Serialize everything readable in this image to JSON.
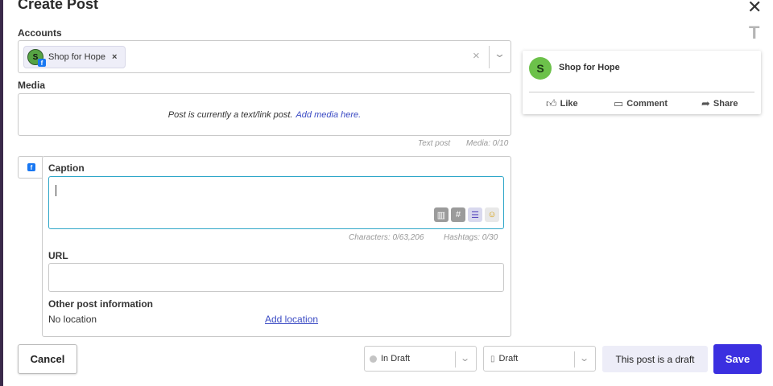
{
  "modal": {
    "title": "Create Post"
  },
  "accounts": {
    "label": "Accounts",
    "selected": [
      {
        "avatar_letter": "S",
        "name": "Shop for Hope",
        "network": "facebook"
      }
    ],
    "remove_glyph": "×",
    "clear_glyph": "×"
  },
  "media": {
    "label": "Media",
    "message": "Post is currently a text/link post.",
    "link": "Add media here.",
    "post_type": "Text post",
    "count": "Media: 0/10"
  },
  "caption": {
    "label": "Caption",
    "network_badge": "f",
    "characters": "Characters: 0/63,206",
    "hashtags": "Hashtags: 0/30",
    "tools": [
      "library-icon",
      "hashtag-icon",
      "comment-icon",
      "emoji-icon"
    ]
  },
  "url": {
    "label": "URL",
    "value": ""
  },
  "other_info": {
    "label": "Other post information",
    "location": "No location",
    "add_location": "Add location"
  },
  "preview": {
    "avatar_letter": "S",
    "name": "Shop for Hope",
    "actions": {
      "like": "Like",
      "comment": "Comment",
      "share": "Share"
    }
  },
  "footer": {
    "cancel": "Cancel",
    "status": "In Draft",
    "draft_select": "Draft",
    "draft_note": "This post is a draft",
    "save": "Save"
  },
  "colors": {
    "accent": "#3b2fe0",
    "link": "#3b4bc4",
    "caption_focus": "#2fa7c9",
    "facebook": "#1877f2",
    "avatar_green": "#6cc14a"
  }
}
